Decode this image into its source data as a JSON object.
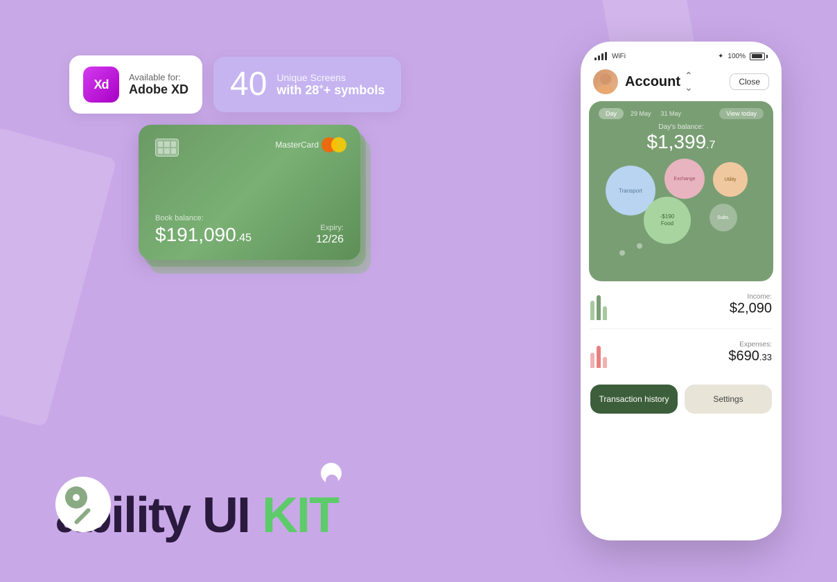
{
  "background": "#c9a8e8",
  "badges": {
    "available_for": "Available for:",
    "adobe_name": "Adobe XD",
    "screens_number": "40",
    "unique_screens": "Unique Screens",
    "with_symbols": "with 28",
    "symbols_suffix": "+ symbols"
  },
  "card": {
    "brand": "MasterCard",
    "balance_label": "Book balance:",
    "balance_main": "$191,090",
    "balance_cents": ".45",
    "expiry_label": "Expiry:",
    "expiry_value": "12/26"
  },
  "phone": {
    "title": "Account",
    "close_button": "Close",
    "status_percent": "100%",
    "tabs": {
      "day": "Day",
      "date1": "29 May",
      "date2": "31 May"
    },
    "view_today": "View today",
    "balance_label": "Day's balance:",
    "balance_main": "$1,399",
    "balance_cents": ".7",
    "bubbles": [
      {
        "label": "Transport"
      },
      {
        "label": "Exchange"
      },
      {
        "label": "Utility"
      },
      {
        "label": "-$190\nFood"
      },
      {
        "label": "Subs."
      }
    ],
    "income_label": "Income:",
    "income_amount": "$2,090",
    "expenses_label": "Expenses:",
    "expenses_main": "$690",
    "expenses_cents": ".33",
    "btn_transaction": "Transaction history",
    "btn_settings": "Settings"
  },
  "brand": {
    "name_part1": "ability UI ",
    "name_part2": "KIT"
  }
}
